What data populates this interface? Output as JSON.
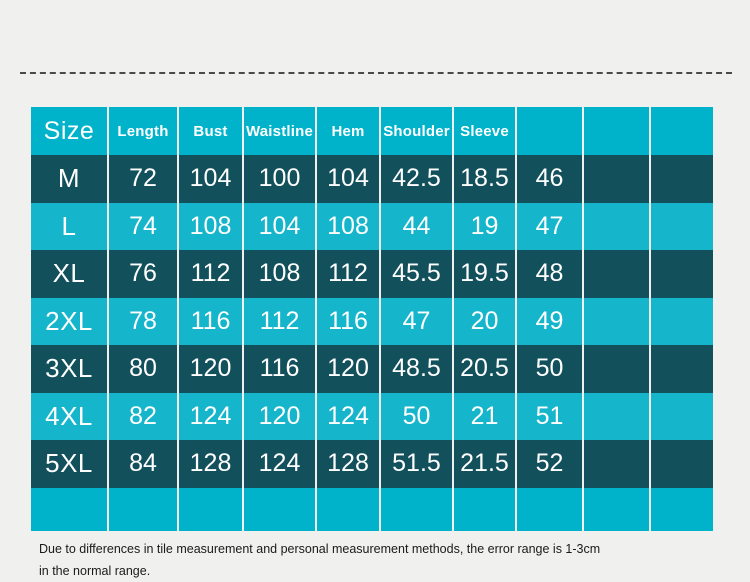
{
  "page": {
    "background_color": "#f0f0ee",
    "divider": {
      "name": "dashed-rule",
      "color": "#4a4a4a",
      "style": "dashed"
    }
  },
  "table": {
    "colors": {
      "header": "#00b3cb",
      "row_dark": "#12505c",
      "row_light": "#15b6cc",
      "gridline": "#f0f0ee",
      "text": "#ffffff"
    },
    "column_count": 10,
    "headers": [
      "Size",
      "Length",
      "Bust",
      "Waistline",
      "Hem",
      "Shoulder",
      "Sleeve",
      "",
      "",
      ""
    ],
    "rows": [
      {
        "size": "M",
        "values": [
          "72",
          "104",
          "100",
          "104",
          "42.5",
          "18.5",
          "46",
          "",
          ""
        ],
        "shade": "dark"
      },
      {
        "size": "L",
        "values": [
          "74",
          "108",
          "104",
          "108",
          "44",
          "19",
          "47",
          "",
          ""
        ],
        "shade": "light"
      },
      {
        "size": "XL",
        "values": [
          "76",
          "112",
          "108",
          "112",
          "45.5",
          "19.5",
          "48",
          "",
          ""
        ],
        "shade": "dark"
      },
      {
        "size": "2XL",
        "values": [
          "78",
          "116",
          "112",
          "116",
          "47",
          "20",
          "49",
          "",
          ""
        ],
        "shade": "light"
      },
      {
        "size": "3XL",
        "values": [
          "80",
          "120",
          "116",
          "120",
          "48.5",
          "20.5",
          "50",
          "",
          ""
        ],
        "shade": "dark"
      },
      {
        "size": "4XL",
        "values": [
          "82",
          "124",
          "120",
          "124",
          "50",
          "21",
          "51",
          "",
          ""
        ],
        "shade": "light"
      },
      {
        "size": "5XL",
        "values": [
          "84",
          "128",
          "124",
          "128",
          "51.5",
          "21.5",
          "52",
          "",
          ""
        ],
        "shade": "dark"
      }
    ],
    "blank_row": {
      "cells": [
        "",
        "",
        "",
        "",
        "",
        "",
        "",
        "",
        "",
        ""
      ]
    }
  },
  "note": {
    "line1": "Due to differences in tile measurement and personal measurement methods, the error range is 1-3cm",
    "line2": "in the normal range."
  }
}
